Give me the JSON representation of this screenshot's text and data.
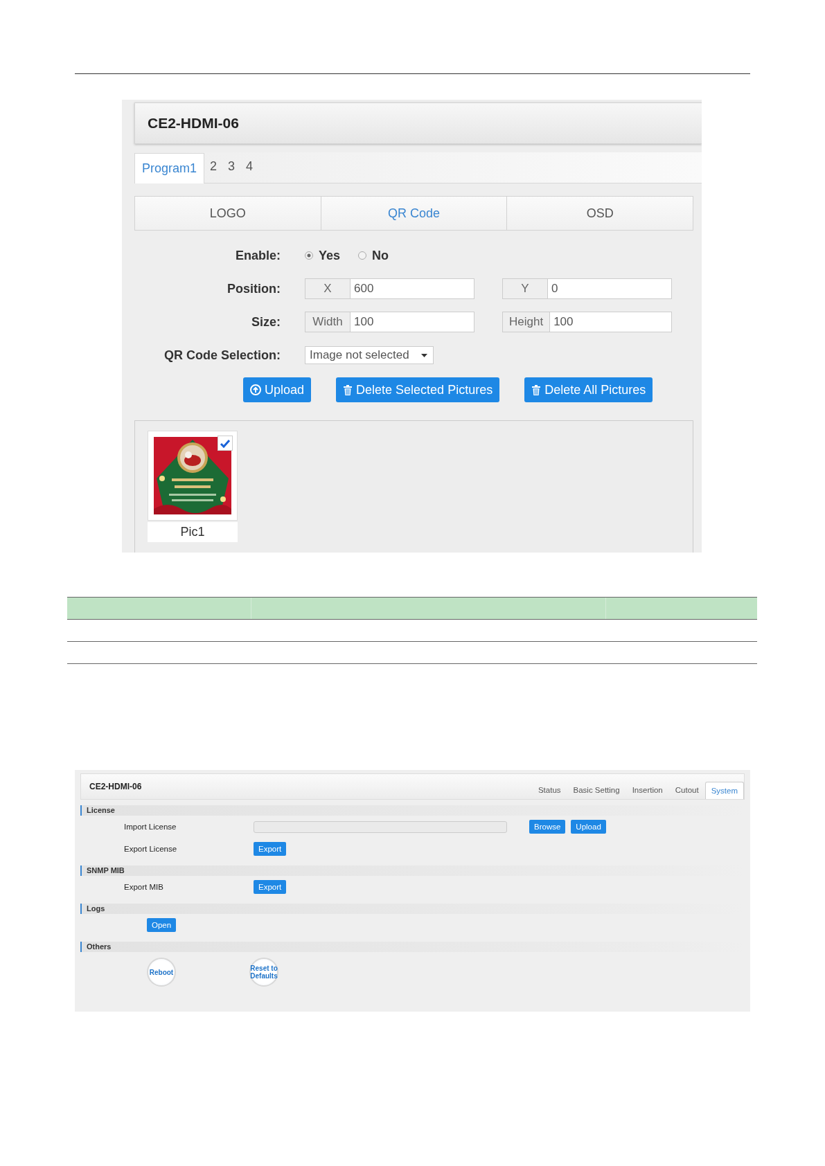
{
  "screen_1": {
    "title": "CE2-HDMI-06",
    "program_tabs": [
      {
        "label": "Program1",
        "selected": true
      },
      {
        "label": "2",
        "selected": false
      },
      {
        "label": "3",
        "selected": false
      },
      {
        "label": "4",
        "selected": false
      }
    ],
    "feature_tabs": [
      {
        "label": "LOGO",
        "selected": false
      },
      {
        "label": "QR Code",
        "selected": true
      },
      {
        "label": "OSD",
        "selected": false
      }
    ],
    "enable": {
      "label": "Enable:",
      "options": [
        {
          "label": "Yes",
          "selected": true
        },
        {
          "label": "No",
          "selected": false
        }
      ]
    },
    "position": {
      "label": "Position:",
      "fields": [
        {
          "prefix": "X",
          "value": "600"
        },
        {
          "prefix": "Y",
          "value": "0"
        }
      ]
    },
    "size": {
      "label": "Size:",
      "fields": [
        {
          "prefix": "Width",
          "value": "100"
        },
        {
          "prefix": "Height",
          "value": "100"
        }
      ]
    },
    "qr_selection": {
      "label": "QR Code Selection:",
      "value": "Image not selected"
    },
    "buttons": [
      {
        "kind": "upload",
        "label": "Upload"
      },
      {
        "kind": "delete",
        "label": "Delete Selected Pictures"
      },
      {
        "kind": "delete",
        "label": "Delete All Pictures"
      }
    ],
    "pictures": [
      {
        "kind": "picture",
        "caption": "Pic1",
        "checked": true
      }
    ]
  },
  "screen_2": {
    "title": "CE2-HDMI-06",
    "nav_tabs": [
      {
        "label": "Status",
        "selected": false
      },
      {
        "label": "Basic Setting",
        "selected": false
      },
      {
        "label": "Insertion",
        "selected": false
      },
      {
        "label": "Cutout",
        "selected": false
      },
      {
        "label": "System",
        "selected": true
      }
    ],
    "sections": [
      {
        "title": "License",
        "rows": [
          {
            "kind": "file",
            "label": "Import License",
            "buttons": [
              "Browse",
              "Upload"
            ]
          },
          {
            "kind": "plain",
            "label": "Export License",
            "buttons": [
              "Export"
            ]
          }
        ]
      },
      {
        "title": "SNMP MIB",
        "rows": [
          {
            "kind": "plain",
            "label": "Export MIB",
            "buttons": [
              "Export"
            ]
          }
        ]
      },
      {
        "title": "Logs",
        "rows": [
          {
            "kind": "plain",
            "buttons": [
              "Open"
            ]
          }
        ]
      },
      {
        "title": "Others",
        "rows": [
          {
            "kind": "round",
            "buttons": [
              "Reboot",
              "Reset to Defaults"
            ]
          }
        ]
      }
    ]
  }
}
